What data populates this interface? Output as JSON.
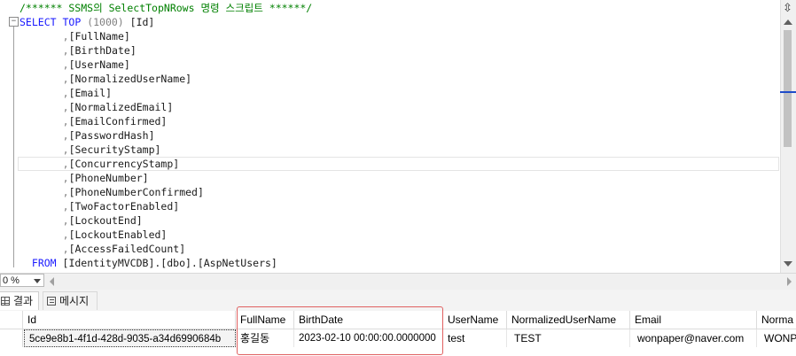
{
  "editor": {
    "lines": [
      {
        "text": "/****** SSMS의 SelectTopNRows 명령 스크립트 ******/",
        "class": "cm",
        "indent": 2
      },
      {
        "parts": [
          {
            "t": "SELECT",
            "c": "kw"
          },
          {
            "t": " ",
            "c": "tx"
          },
          {
            "t": "TOP",
            "c": "kw"
          },
          {
            "t": " (1000) ",
            "c": "gy"
          },
          {
            "t": "[Id]",
            "c": "tx"
          }
        ],
        "indent": 2
      },
      {
        "parts": [
          {
            "t": ",",
            "c": "gy"
          },
          {
            "t": "[FullName]",
            "c": "tx"
          }
        ],
        "indent": 9
      },
      {
        "parts": [
          {
            "t": ",",
            "c": "gy"
          },
          {
            "t": "[BirthDate]",
            "c": "tx"
          }
        ],
        "indent": 9
      },
      {
        "parts": [
          {
            "t": ",",
            "c": "gy"
          },
          {
            "t": "[UserName]",
            "c": "tx"
          }
        ],
        "indent": 9
      },
      {
        "parts": [
          {
            "t": ",",
            "c": "gy"
          },
          {
            "t": "[NormalizedUserName]",
            "c": "tx"
          }
        ],
        "indent": 9
      },
      {
        "parts": [
          {
            "t": ",",
            "c": "gy"
          },
          {
            "t": "[Email]",
            "c": "tx"
          }
        ],
        "indent": 9
      },
      {
        "parts": [
          {
            "t": ",",
            "c": "gy"
          },
          {
            "t": "[NormalizedEmail]",
            "c": "tx"
          }
        ],
        "indent": 9
      },
      {
        "parts": [
          {
            "t": ",",
            "c": "gy"
          },
          {
            "t": "[EmailConfirmed]",
            "c": "tx"
          }
        ],
        "indent": 9
      },
      {
        "parts": [
          {
            "t": ",",
            "c": "gy"
          },
          {
            "t": "[PasswordHash]",
            "c": "tx"
          }
        ],
        "indent": 9
      },
      {
        "parts": [
          {
            "t": ",",
            "c": "gy"
          },
          {
            "t": "[SecurityStamp]",
            "c": "tx"
          }
        ],
        "indent": 9
      },
      {
        "parts": [
          {
            "t": ",",
            "c": "gy"
          },
          {
            "t": "[ConcurrencyStamp]",
            "c": "tx"
          }
        ],
        "indent": 9
      },
      {
        "parts": [
          {
            "t": ",",
            "c": "gy"
          },
          {
            "t": "[PhoneNumber]",
            "c": "tx"
          }
        ],
        "indent": 9
      },
      {
        "parts": [
          {
            "t": ",",
            "c": "gy"
          },
          {
            "t": "[PhoneNumberConfirmed]",
            "c": "tx"
          }
        ],
        "indent": 9
      },
      {
        "parts": [
          {
            "t": ",",
            "c": "gy"
          },
          {
            "t": "[TwoFactorEnabled]",
            "c": "tx"
          }
        ],
        "indent": 9
      },
      {
        "parts": [
          {
            "t": ",",
            "c": "gy"
          },
          {
            "t": "[LockoutEnd]",
            "c": "tx"
          }
        ],
        "indent": 9
      },
      {
        "parts": [
          {
            "t": ",",
            "c": "gy"
          },
          {
            "t": "[LockoutEnabled]",
            "c": "tx"
          }
        ],
        "indent": 9
      },
      {
        "parts": [
          {
            "t": ",",
            "c": "gy"
          },
          {
            "t": "[AccessFailedCount]",
            "c": "tx"
          }
        ],
        "indent": 9
      },
      {
        "parts": [
          {
            "t": "FROM",
            "c": "kw"
          },
          {
            "t": " [IdentityMVCDB].[dbo].[AspNetUsers]",
            "c": "tx"
          }
        ],
        "indent": 4
      }
    ],
    "fold_symbol": "−",
    "split_symbol": "⇳"
  },
  "zoom": {
    "value": "0 %"
  },
  "results_tabs": [
    {
      "label": "결과",
      "icon": "grid-icon"
    },
    {
      "label": "메시지",
      "icon": "message-icon"
    }
  ],
  "grid": {
    "columns": [
      "Id",
      "FullName",
      "BirthDate",
      "UserName",
      "NormalizedUserName",
      "Email",
      "Norma"
    ],
    "rows": [
      [
        "5ce9e8b1-4f1d-428d-9035-a34d6990684b",
        "홍길동",
        "2023-02-10 00:00:00.0000000",
        "test",
        "TEST",
        "wonpaper@naver.com",
        "WONP"
      ]
    ]
  },
  "colors": {
    "keyword": "#1a1aff",
    "comment": "#008000",
    "highlight_box": "#e06060"
  }
}
